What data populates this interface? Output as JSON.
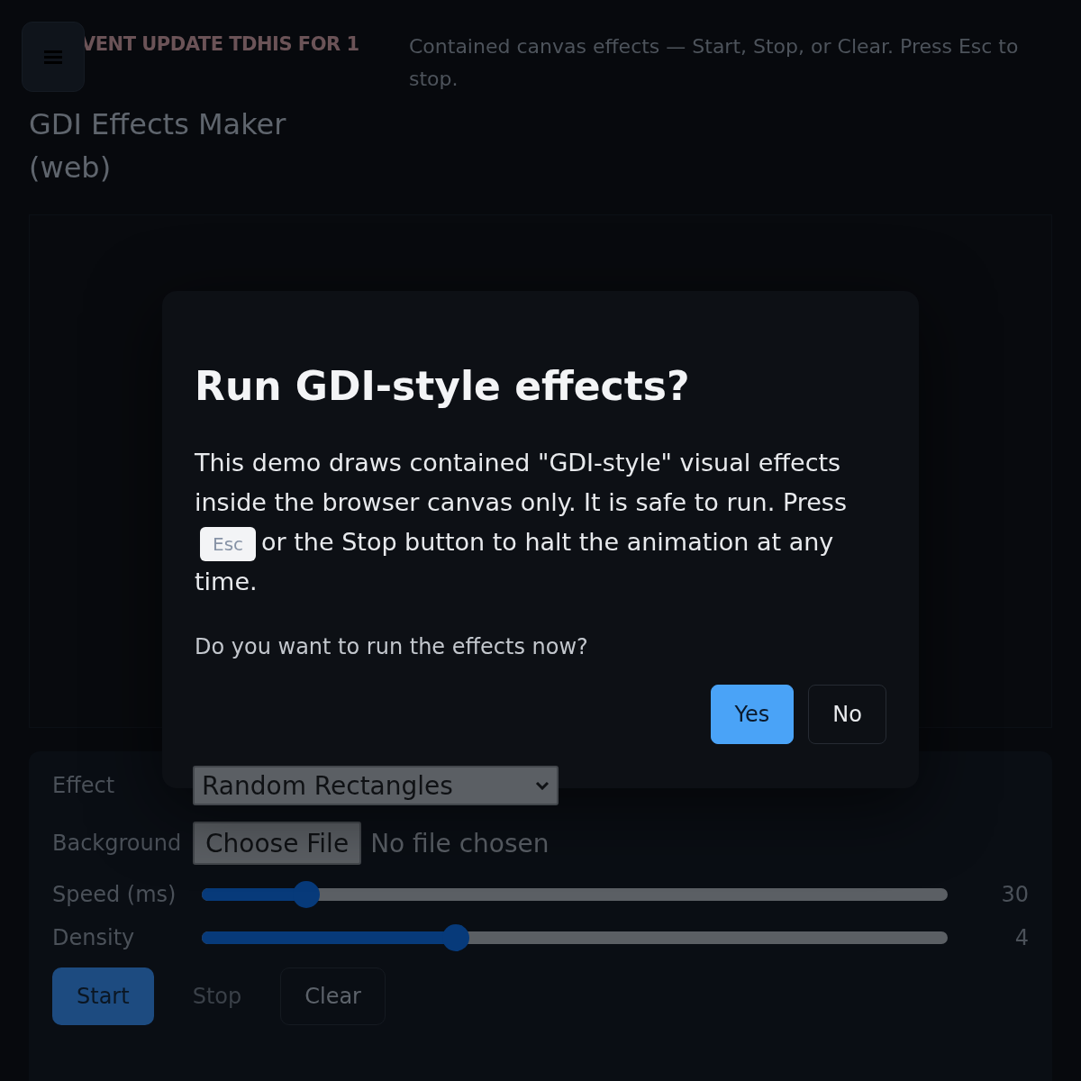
{
  "header": {
    "banner": "VENT UPDATE TDHIS FOR 1",
    "title": "GDI Effects Maker (web)",
    "subtitle": "Contained canvas effects — Start, Stop, or Clear. Press Esc to stop."
  },
  "controls": {
    "effect": {
      "label": "Effect",
      "value": "Random Rectangles"
    },
    "background": {
      "label": "Background",
      "button": "Choose File",
      "status": "No file chosen"
    },
    "sliders": [
      {
        "label": "Speed (ms)",
        "level": 0.14,
        "reading": "30"
      },
      {
        "label": "Density",
        "level": 0.34,
        "reading": "4"
      }
    ],
    "buttons": [
      {
        "label": "Start",
        "kind": "primary"
      },
      {
        "label": "Stop",
        "kind": "ghost"
      },
      {
        "label": "Clear",
        "kind": "outline"
      }
    ]
  },
  "dialog": {
    "title": "Run GDI-style effects?",
    "body_before": "This demo draws contained \"GDI-style\" visual effects inside the browser canvas only. It is safe to run. Press",
    "key": "Esc",
    "body_after": "or the Stop button to halt the animation at any time.",
    "question": "Do you want to run the effects now?",
    "buttons": [
      {
        "label": "Yes",
        "kind": "primary"
      },
      {
        "label": "No",
        "kind": "outline"
      }
    ]
  }
}
